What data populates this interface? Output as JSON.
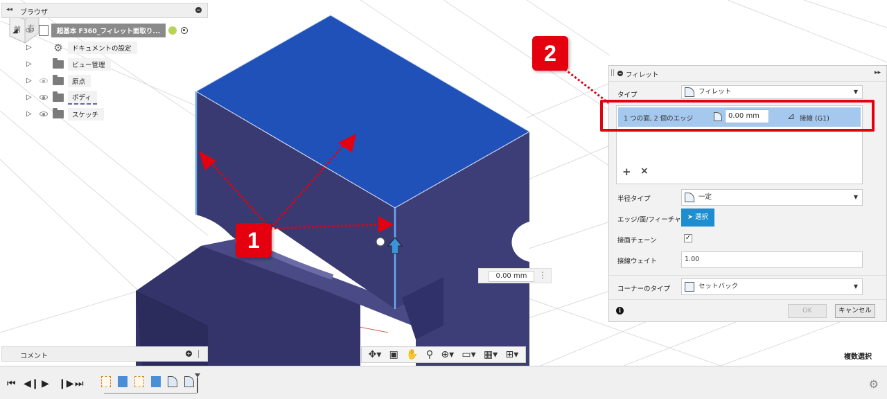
{
  "browser": {
    "title": "ブラウザ",
    "root_label": "超基本 F360_フィレット面取り...",
    "items": [
      {
        "label": "ドキュメントの設定",
        "icon": "gear-icon"
      },
      {
        "label": "ビュー管理",
        "icon": "folder-icon"
      },
      {
        "label": "原点",
        "icon": "folder-icon",
        "visible": false
      },
      {
        "label": "ボディ",
        "icon": "folder-icon",
        "visible": true
      },
      {
        "label": "スケッチ",
        "icon": "folder-icon",
        "visible": true
      }
    ]
  },
  "comments": {
    "title": "コメント"
  },
  "viewport": {
    "dimension_value": "0.00 mm",
    "status_text": "複数選択",
    "viewcube": {
      "top": "上",
      "front": "前",
      "right": "右",
      "axis_z": "Z"
    }
  },
  "badges": {
    "one": "1",
    "two": "2"
  },
  "fillet_dialog": {
    "title": "フィレット",
    "type_label": "タイプ",
    "type_value": "フィレット",
    "selection_row": {
      "description": "1 つの面, 2 個のエッジ",
      "radius": "0.00 mm",
      "continuity": "接線 (G1)"
    },
    "add_symbol": "+",
    "remove_symbol": "×",
    "radius_type_label": "半径タイプ",
    "radius_type_value": "一定",
    "edge_label": "エッジ/面/フィーチャ",
    "select_button": "選択",
    "tangent_chain_label": "接面チェーン",
    "tangent_chain_checked": true,
    "tangent_weight_label": "接線ウェイト",
    "tangent_weight_value": "1.00",
    "corner_type_label": "コーナーのタイプ",
    "corner_type_value": "セットバック",
    "ok_label": "OK",
    "cancel_label": "キャンセル"
  },
  "colors": {
    "top_face": "#1f51b8",
    "body": "#3d3d75",
    "accent_red": "#e4000f",
    "selection_highlight": "#a5c8ef",
    "select_button": "#1e8ed0"
  }
}
